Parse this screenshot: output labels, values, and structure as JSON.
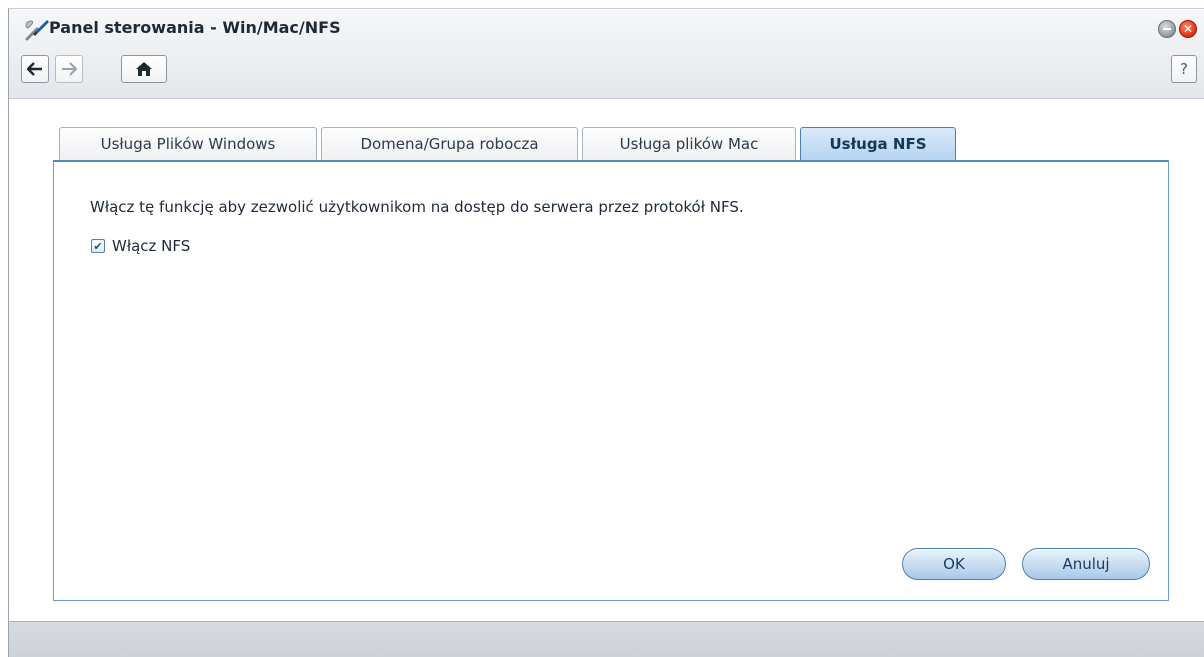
{
  "window": {
    "title": "Panel sterowania - Win/Mac/NFS",
    "app_icon": "tools-icon",
    "controls": {
      "minimize_icon": "minimize-icon",
      "close_icon": "close-icon"
    }
  },
  "toolbar": {
    "back_icon": "arrow-left-icon",
    "forward_icon": "arrow-right-icon",
    "home_icon": "home-icon",
    "help_label": "?"
  },
  "tabs": [
    {
      "label": "Usługa Plików Windows",
      "active": false
    },
    {
      "label": "Domena/Grupa robocza",
      "active": false
    },
    {
      "label": "Usługa plików Mac",
      "active": false
    },
    {
      "label": "Usługa NFS",
      "active": true
    }
  ],
  "nfs": {
    "description": "Włącz tę funkcję aby zezwolić użytkownikom na dostęp do serwera przez protokół NFS.",
    "enable_label": "Włącz NFS",
    "enable_checked": true
  },
  "buttons": {
    "ok": "OK",
    "cancel": "Anuluj"
  },
  "colors": {
    "accent": "#4f8ac0",
    "active_tab": "#b5d2ee",
    "close": "#e23a1f"
  }
}
